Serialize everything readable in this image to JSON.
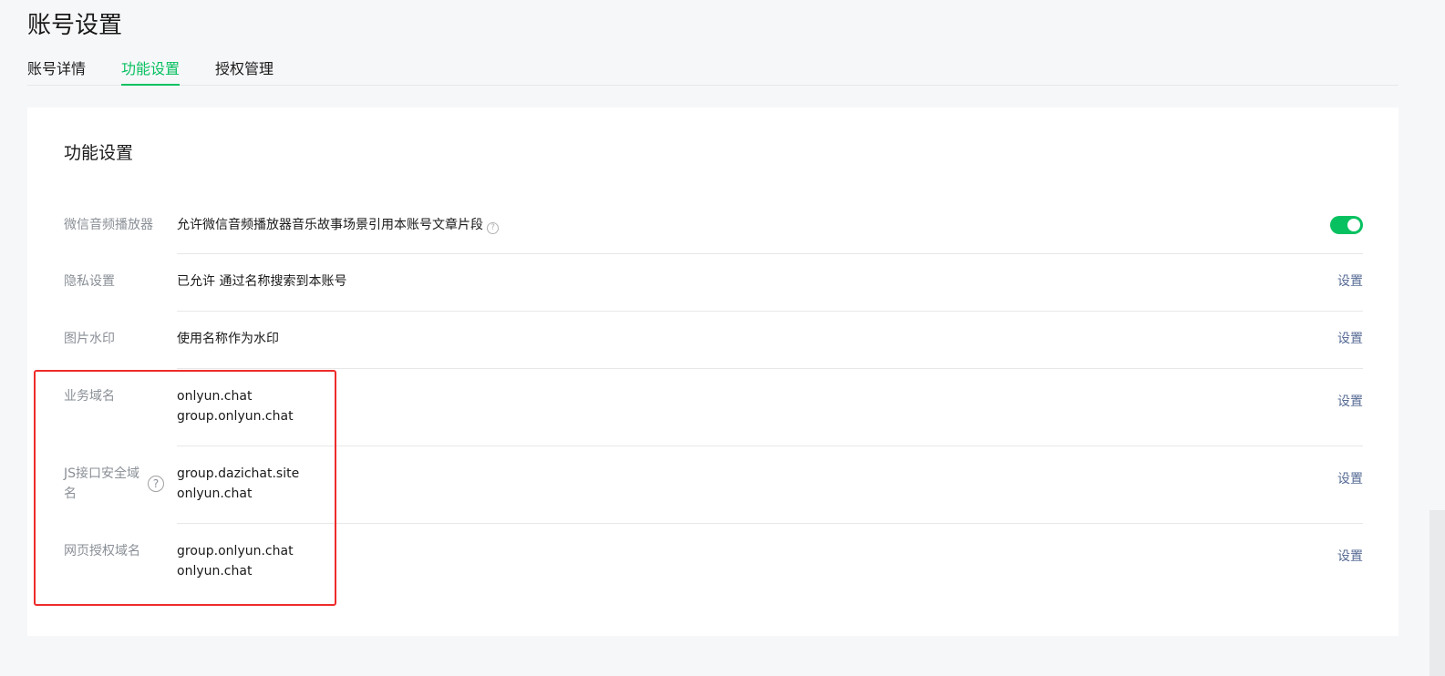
{
  "page": {
    "title": "账号设置"
  },
  "tabs": [
    {
      "label": "账号详情",
      "active": false
    },
    {
      "label": "功能设置",
      "active": true
    },
    {
      "label": "授权管理",
      "active": false
    }
  ],
  "section": {
    "title": "功能设置"
  },
  "rows": {
    "audio": {
      "label": "微信音频播放器",
      "value": "允许微信音频播放器音乐故事场景引用本账号文章片段",
      "toggle_on": true
    },
    "privacy": {
      "label": "隐私设置",
      "value": "已允许 通过名称搜索到本账号",
      "action": "设置"
    },
    "watermark": {
      "label": "图片水印",
      "value": "使用名称作为水印",
      "action": "设置"
    },
    "business_domain": {
      "label": "业务域名",
      "values": [
        "onlyun.chat",
        "group.onlyun.chat"
      ],
      "action": "设置"
    },
    "js_domain": {
      "label_line1": "JS接口安全域",
      "label_line2": "名",
      "values": [
        "group.dazichat.site",
        "onlyun.chat"
      ],
      "action": "设置"
    },
    "oauth_domain": {
      "label": "网页授权域名",
      "values": [
        "group.onlyun.chat",
        "onlyun.chat"
      ],
      "action": "设置"
    }
  },
  "icons": {
    "help": "?",
    "accent_color": "#07c160",
    "link_color": "#576b95",
    "highlight_color": "#ee2b2b"
  }
}
